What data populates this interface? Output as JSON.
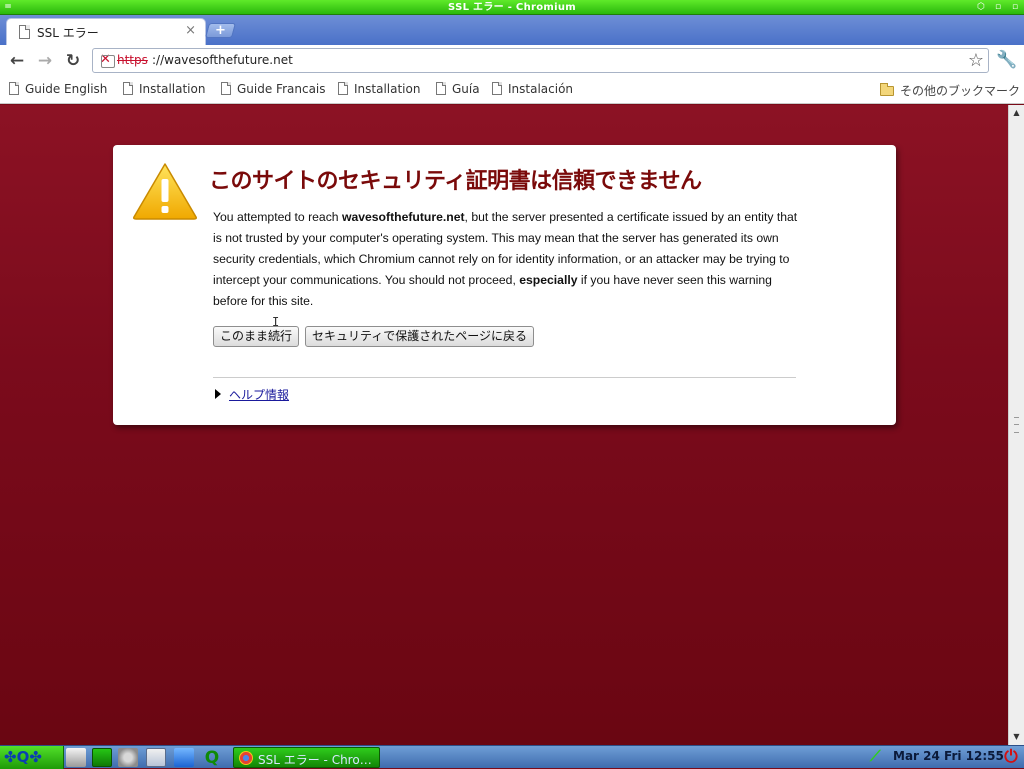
{
  "window": {
    "title": "SSL エラー - Chromium",
    "menu_glyph": "=",
    "minimize_glyph": "⬡",
    "maximize_glyph": "▫",
    "close_glyph": "▫"
  },
  "tab": {
    "title": "SSL エラー",
    "close": "×",
    "new_tab": "+"
  },
  "toolbar": {
    "back": "←",
    "forward": "→",
    "reload": "↻",
    "url_scheme": "https",
    "url_rest": "://wavesofthefuture.net",
    "star": "☆",
    "wrench": "🔧"
  },
  "bookmarks": {
    "items": [
      "Guide English",
      "Installation",
      "Guide Francais",
      "Installation",
      "Guía",
      "Instalación"
    ],
    "other": "その他のブックマーク"
  },
  "page": {
    "heading": "このサイトのセキュリティ証明書は信頼できません",
    "body_1": "You attempted to reach ",
    "body_domain": "wavesofthefuture.net",
    "body_2": ", but the server presented a certificate issued by an entity that is not trusted by your computer's operating system. This may mean that the server has generated its own security credentials, which Chromium cannot rely on for identity information, or an attacker may be trying to intercept your communications. You should not proceed, ",
    "body_emph": "especially",
    "body_3": " if you have never seen this warning before for this site.",
    "proceed_button": "このまま続行",
    "back_button": "セキュリティで保護されたページに戻る",
    "help_link": "ヘルプ情報",
    "cursor": "I"
  },
  "taskbar": {
    "start_glyphs": "✤Q✤",
    "task_title": "SSL エラー - Chro…",
    "clock": "Mar 24 Fri 12:55",
    "power": "⏻",
    "net": "⟋"
  },
  "colors": {
    "page_bg": "#7a0a18",
    "heading": "#7a0a0a",
    "titlebar": "#2ab80c",
    "tabstrip": "#4a71c8"
  }
}
